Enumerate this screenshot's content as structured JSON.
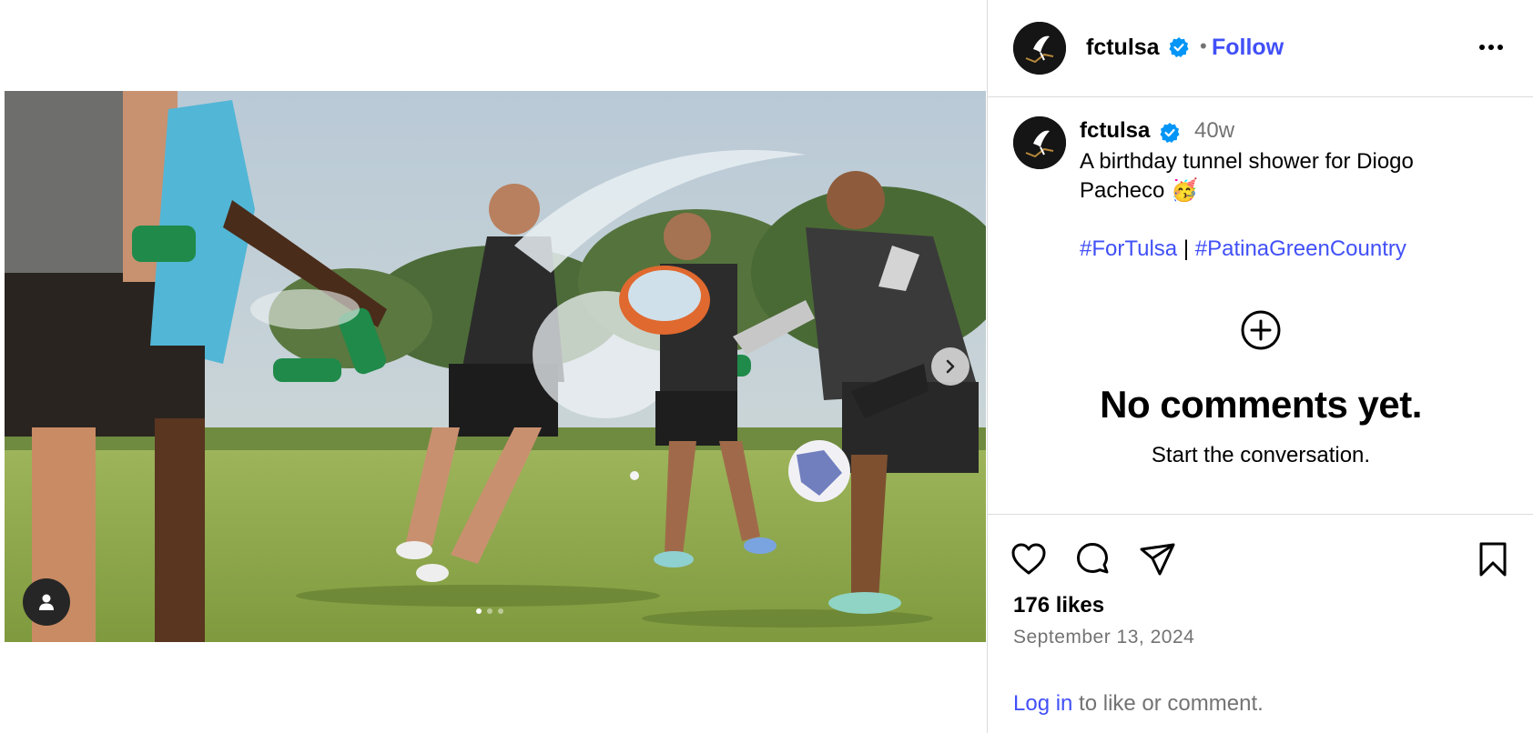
{
  "post": {
    "username": "fctulsa",
    "follow_label": "Follow",
    "separator": "•",
    "time_ago": "40w",
    "caption": "A birthday tunnel shower for Diogo Pacheco 🥳",
    "hashtags": [
      "#ForTulsa",
      "#PatinaGreenCountry"
    ],
    "hashtag_separator": "|",
    "likes": "176 likes",
    "date": "September 13, 2024"
  },
  "comments": {
    "empty_title": "No comments yet.",
    "empty_subtitle": "Start the conversation."
  },
  "footer": {
    "login_link": "Log in",
    "login_rest": " to like or comment."
  },
  "carousel": {
    "slide_count": 3,
    "active_index": 0
  },
  "icons": {
    "verified": "verified-badge-icon",
    "more": "more-options-icon",
    "like": "heart-icon",
    "comment": "comment-icon",
    "share": "share-icon",
    "save": "bookmark-icon",
    "add_comment": "plus-circle-icon",
    "next": "chevron-right-icon",
    "tagged_users": "user-icon"
  },
  "colors": {
    "link": "#4150f7",
    "verified": "#0095f6",
    "muted": "#737373",
    "border": "#dbdbdb"
  }
}
